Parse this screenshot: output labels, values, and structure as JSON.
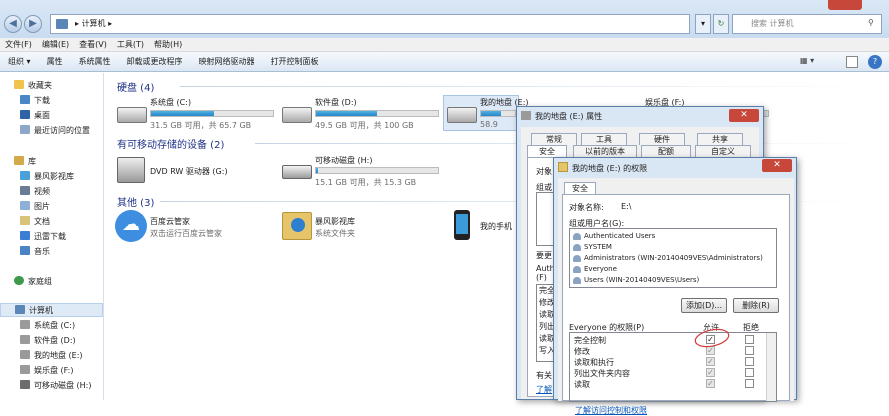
{
  "address": {
    "path": "计算机",
    "search_placeholder": "搜索 计算机"
  },
  "menu": [
    "文件(F)",
    "编辑(E)",
    "查看(V)",
    "工具(T)",
    "帮助(H)"
  ],
  "toolbar": [
    "组织 ▾",
    "属性",
    "系统属性",
    "卸载或更改程序",
    "映射网络驱动器",
    "打开控制面板"
  ],
  "sidebar": {
    "favorites": "收藏夹",
    "fav_items": [
      "下载",
      "桌面",
      "最近访问的位置"
    ],
    "library": "库",
    "lib_items": [
      "暴风影视库",
      "视频",
      "图片",
      "文档",
      "迅雷下载",
      "音乐"
    ],
    "homegroup": "家庭组",
    "computer": "计算机",
    "drives": [
      "系统盘 (C:)",
      "软件盘 (D:)",
      "我的地盘 (E:)",
      "娱乐盘 (F:)",
      "可移动磁盘 (H:)"
    ]
  },
  "groups": {
    "hdd": "硬盘 (4)",
    "removable": "有可移动存储的设备 (2)",
    "other": "其他 (3)"
  },
  "drives": [
    {
      "name": "系统盘 (C:)",
      "size": "31.5 GB 可用，共 65.7 GB",
      "used": 0.52
    },
    {
      "name": "软件盘 (D:)",
      "size": "49.5 GB 可用，共 100 GB",
      "used": 0.5
    },
    {
      "name": "我的地盘 (E:)",
      "size": "58.9",
      "used": 0.6
    },
    {
      "name": "娱乐盘 (F:)",
      "size": "",
      "used": 0.5
    }
  ],
  "removable": [
    {
      "name": "DVD RW 驱动器 (G:)"
    },
    {
      "name": "可移动磁盘 (H:)",
      "size": "15.1 GB 可用，共 15.3 GB",
      "used": 0.02
    }
  ],
  "other": [
    {
      "name": "百度云管家",
      "sub": "双击运行百度云管家"
    },
    {
      "name": "暴风影视库",
      "sub": "系统文件夹"
    },
    {
      "name": "我的手机"
    }
  ],
  "dlg1": {
    "title": "我的地盘 (E:) 属性",
    "tabs_row1": [
      "常规",
      "工具",
      "硬件",
      "共享"
    ],
    "tabs_row2": [
      "安全",
      "以前的版本",
      "配额",
      "自定义"
    ],
    "obj": "对象",
    "grp": "组或",
    "change": "要更",
    "perm": "Authe",
    "perm2": "(F)",
    "rows": [
      "完全",
      "修改",
      "读取",
      "列出",
      "读取",
      "写入"
    ],
    "special": "有关",
    "link": "了解"
  },
  "dlg2": {
    "title": "我的地盘 (E:) 的权限",
    "tab": "安全",
    "obj_label": "对象名称:",
    "obj_value": "E:\\",
    "group_label": "组或用户名(G):",
    "users": [
      "Authenticated Users",
      "SYSTEM",
      "Administrators (WIN-20140409VES\\Administrators)",
      "Everyone",
      "Users (WIN-20140409VES\\Users)"
    ],
    "add": "添加(D)...",
    "remove": "删除(R)",
    "perm_label": "Everyone 的权限(P)",
    "allow": "允许",
    "deny": "拒绝",
    "perms": [
      "完全控制",
      "修改",
      "读取和执行",
      "列出文件夹内容",
      "读取"
    ],
    "link": "了解访问控制和权限"
  },
  "colors": {
    "accent": "#2786c9",
    "annotation": "#d43a3a"
  }
}
